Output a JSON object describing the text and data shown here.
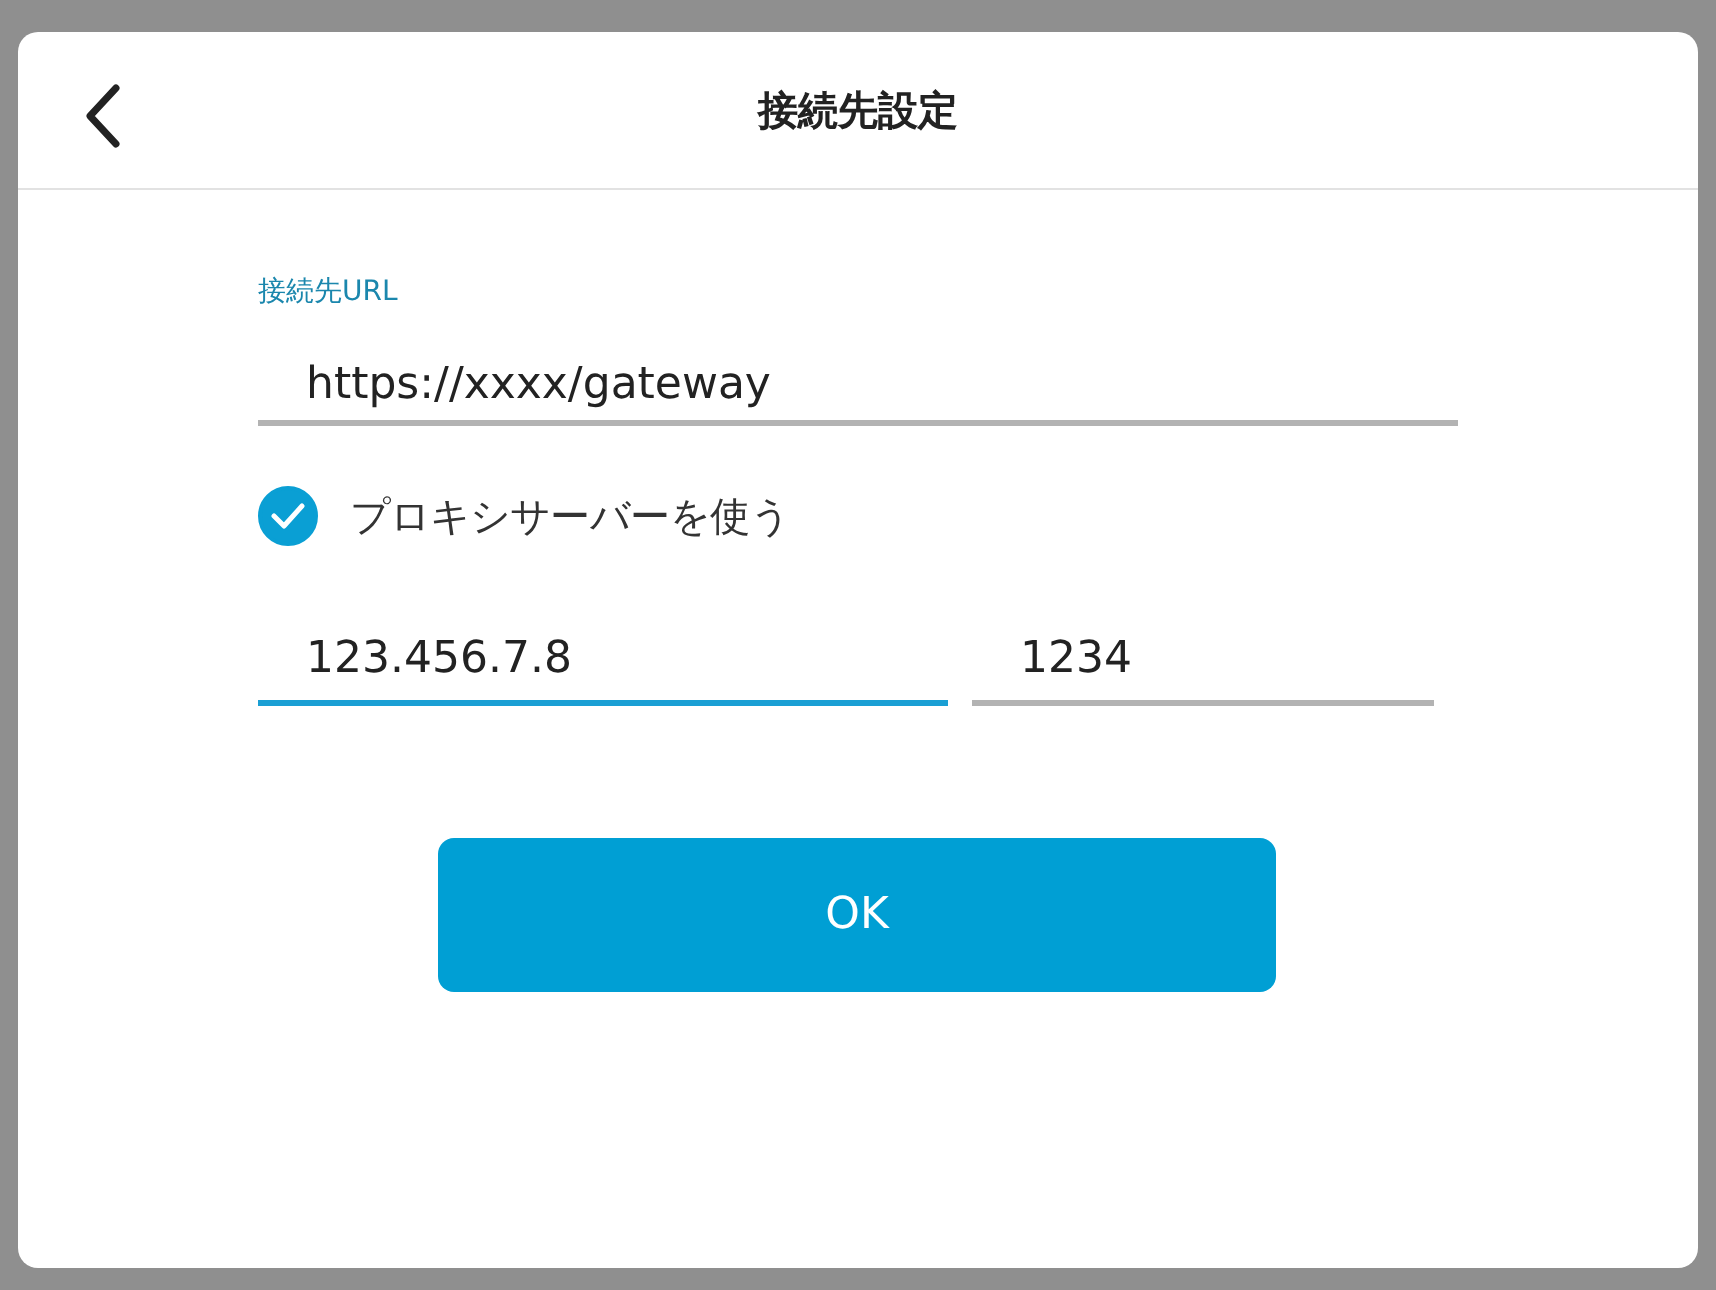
{
  "dialog": {
    "title": "接続先設定"
  },
  "url_field": {
    "label": "接続先URL",
    "value": "https://xxxx/gateway",
    "focused": false
  },
  "proxy": {
    "label": "プロキシサーバーを使う",
    "checked": true
  },
  "proxy_fields": [
    {
      "value": "123.456.7.8",
      "focused": true
    },
    {
      "value": "1234",
      "focused": false
    }
  ],
  "ok_button": {
    "label": "OK"
  }
}
